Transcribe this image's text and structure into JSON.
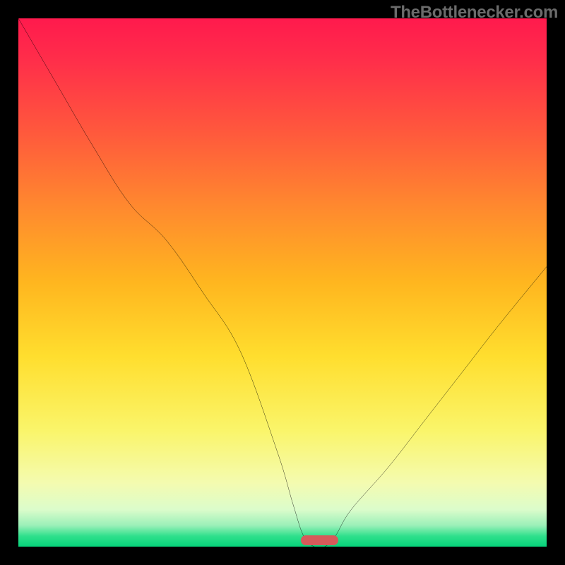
{
  "watermark": "TheBottlenecker.com",
  "chart_data": {
    "type": "line",
    "title": "",
    "xlabel": "",
    "ylabel": "",
    "xlim": [
      0,
      100
    ],
    "ylim": [
      0,
      100
    ],
    "x": [
      0,
      7,
      14,
      21,
      28,
      35,
      42,
      49,
      52,
      54,
      56,
      58,
      60,
      63,
      70,
      77,
      84,
      91,
      100
    ],
    "values": [
      100,
      88,
      76,
      65,
      58,
      48,
      37,
      18,
      8,
      2,
      0,
      0,
      2,
      7,
      15,
      24,
      33,
      42,
      53
    ],
    "min_marker": {
      "x_start": 53.5,
      "x_end": 60.5,
      "value": 0
    },
    "gradient_colors": {
      "top": "#ff1a4d",
      "mid": "#ffde2e",
      "bottom": "#06d27a"
    }
  }
}
